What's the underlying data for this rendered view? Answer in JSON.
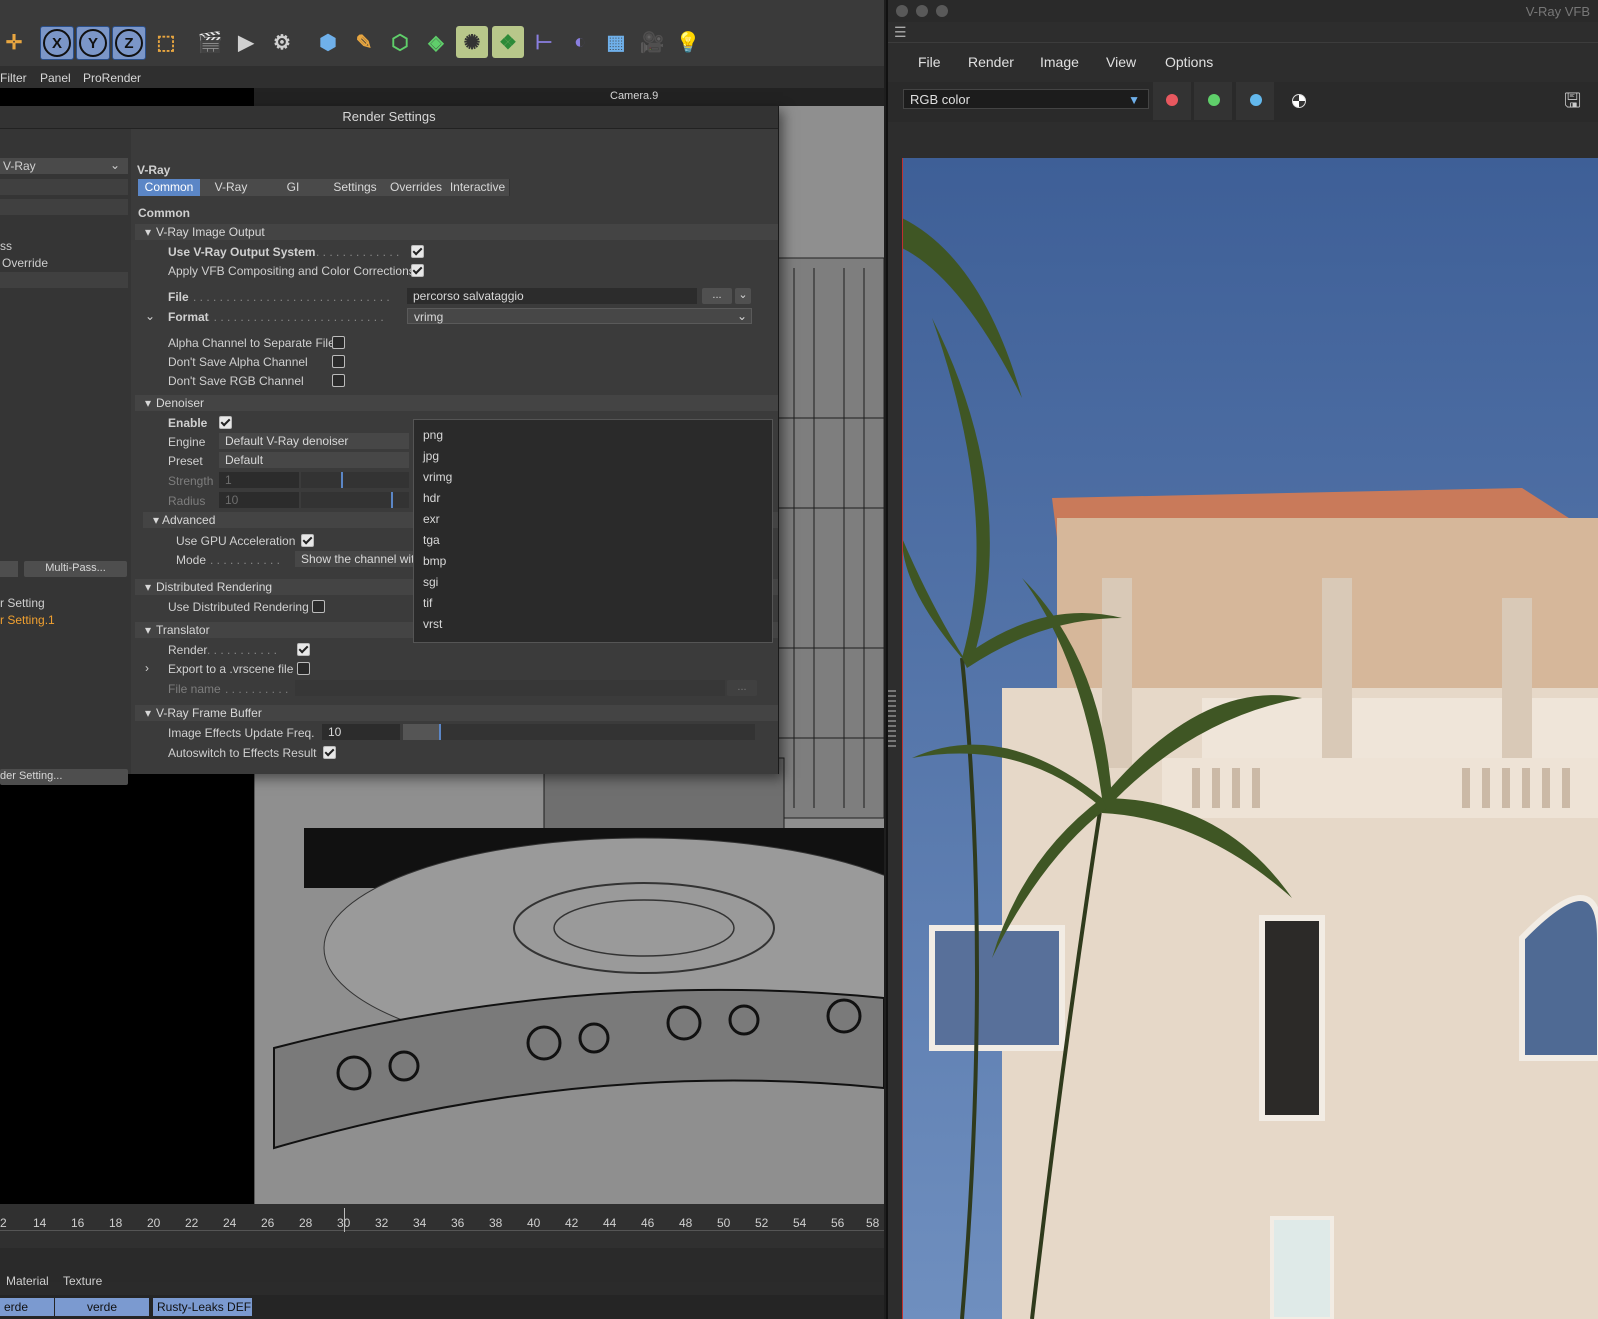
{
  "toolbar": {
    "axis_x": "X",
    "axis_y": "Y",
    "axis_z": "Z"
  },
  "menubar": {
    "items": [
      "Filter",
      "Panel",
      "ProRender"
    ]
  },
  "viewport": {
    "camera_label": "Camera.9"
  },
  "render_settings": {
    "title": "Render Settings",
    "renderer": "V-Ray",
    "left_panel": {
      "item1": "ss",
      "item2": "Override",
      "multipass": "Multi-Pass...",
      "setting": "r Setting",
      "setting_active": "r Setting.1",
      "render_setting_btn": "der Setting..."
    },
    "header": "V-Ray",
    "tabs": [
      "Common",
      "V-Ray",
      "GI",
      "Settings",
      "Overrides",
      "Interactive"
    ],
    "section_title": "Common",
    "image_output": {
      "title": "V-Ray Image Output",
      "use_output_system": "Use V-Ray Output System",
      "apply_vfb": "Apply VFB Compositing and Color Corrections",
      "file_label": "File",
      "file_value": "percorso salvataggio",
      "file_btn": "...",
      "format_label": "Format",
      "format_value": "vrimg",
      "alpha_separate": "Alpha Channel to Separate File",
      "dont_save_alpha": "Don't Save Alpha Channel",
      "dont_save_rgb": "Don't Save RGB Channel"
    },
    "format_options": [
      "png",
      "jpg",
      "vrimg",
      "hdr",
      "exr",
      "tga",
      "bmp",
      "sgi",
      "tif",
      "vrst"
    ],
    "denoiser": {
      "title": "Denoiser",
      "enable": "Enable",
      "engine_label": "Engine",
      "engine_value": "Default V-Ray denoiser",
      "preset_label": "Preset",
      "preset_value": "Default",
      "strength_label": "Strength",
      "strength_value": "1",
      "radius_label": "Radius",
      "radius_value": "10",
      "advanced": "Advanced",
      "gpu": "Use GPU Acceleration",
      "mode_label": "Mode",
      "mode_value": "Show the channel with the denoised result in VFB"
    },
    "distributed": {
      "title": "Distributed Rendering",
      "use": "Use Distributed Rendering"
    },
    "translator": {
      "title": "Translator",
      "render": "Render",
      "export": "Export to a .vrscene file",
      "file_name": "File name",
      "file_btn": "..."
    },
    "vfb_section": {
      "title": "V-Ray Frame Buffer",
      "update_freq": "Image Effects Update Freq.",
      "update_value": "10",
      "autoswitch": "Autoswitch to Effects Result"
    }
  },
  "timeline": {
    "ticks": [
      "2",
      "14",
      "16",
      "18",
      "20",
      "22",
      "24",
      "26",
      "28",
      "30",
      "32",
      "34",
      "36",
      "38",
      "40",
      "42",
      "44",
      "46",
      "48",
      "50",
      "52",
      "54",
      "56",
      "58"
    ]
  },
  "materials": {
    "tab_material": "Material",
    "tab_texture": "Texture",
    "chips": [
      "erde",
      "verde",
      "Rusty-Leaks DEF"
    ]
  },
  "vfb": {
    "title": "V-Ray VFB",
    "menu": [
      "File",
      "Render",
      "Image",
      "View",
      "Options"
    ],
    "channel": "RGB color",
    "colors": {
      "red": "#e8585f",
      "green": "#5fcf6a",
      "blue": "#63b8ec"
    }
  }
}
